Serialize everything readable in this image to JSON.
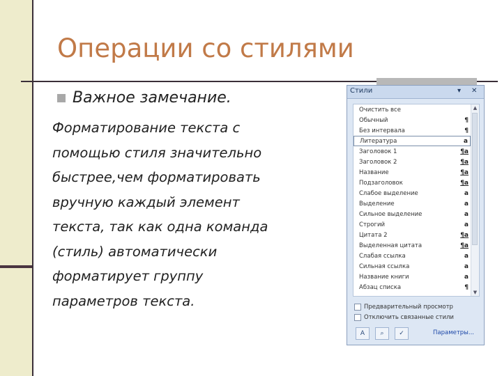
{
  "slide": {
    "title": "Операции со стилями",
    "bullet": "Важное замечание.",
    "body_lines": [
      "Форматирование текста с",
      "помощью стиля значительно",
      "быстрее,чем форматировать",
      "вручную каждый элемент",
      "текста, так как одна команда",
      "(стиль) автоматически",
      "форматирует группу",
      "параметров текста."
    ]
  },
  "styles_pane": {
    "title": "Стили",
    "controls": {
      "menu": "▾",
      "close": "✕"
    },
    "items": [
      {
        "name": "Очистить все",
        "mark": ""
      },
      {
        "name": "Обычный",
        "mark": "¶"
      },
      {
        "name": "Без интервала",
        "mark": "¶"
      },
      {
        "name": "Литература",
        "mark": "a",
        "selected": true
      },
      {
        "name": "Заголовок 1",
        "mark": "¶a"
      },
      {
        "name": "Заголовок 2",
        "mark": "¶a"
      },
      {
        "name": "Название",
        "mark": "¶a"
      },
      {
        "name": "Подзаголовок",
        "mark": "¶a"
      },
      {
        "name": "Слабое выделение",
        "mark": "a"
      },
      {
        "name": "Выделение",
        "mark": "a"
      },
      {
        "name": "Сильное выделение",
        "mark": "a"
      },
      {
        "name": "Строгий",
        "mark": "a"
      },
      {
        "name": "Цитата 2",
        "mark": "¶a"
      },
      {
        "name": "Выделенная цитата",
        "mark": "¶a"
      },
      {
        "name": "Слабая ссылка",
        "mark": "a"
      },
      {
        "name": "Сильная ссылка",
        "mark": "a"
      },
      {
        "name": "Название книги",
        "mark": "a"
      },
      {
        "name": "Абзац списка",
        "mark": "¶"
      }
    ],
    "options": [
      {
        "label": "Предварительный просмотр",
        "checked": false
      },
      {
        "label": "Отключить связанные стили",
        "checked": false
      }
    ],
    "buttons": {
      "new_style_icon": "new-style-icon",
      "inspector_icon": "style-inspector-icon",
      "manage_icon": "manage-styles-icon",
      "params_label": "Параметры..."
    }
  }
}
